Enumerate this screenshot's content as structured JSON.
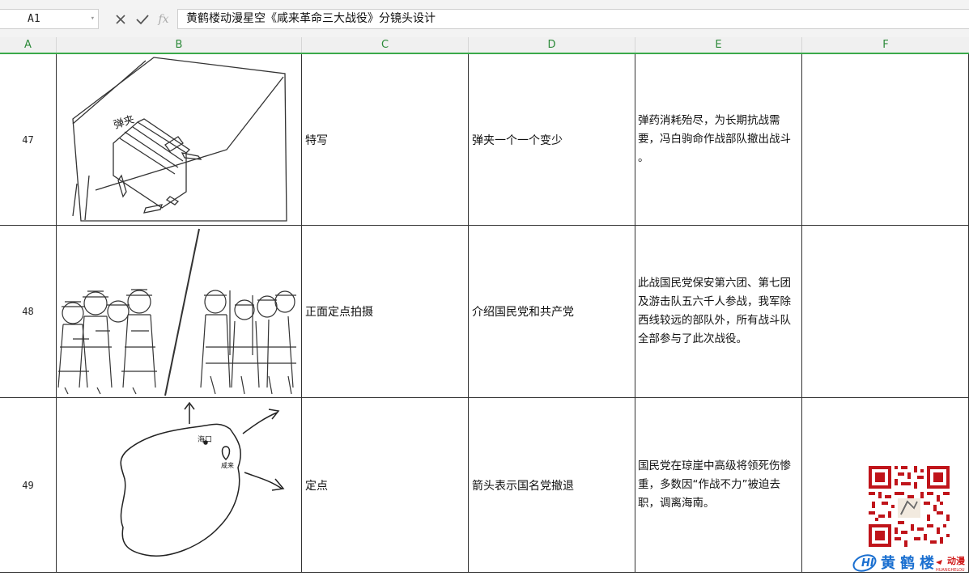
{
  "formula_bar": {
    "name_box": "A1",
    "cancel_icon": "close-icon",
    "enter_icon": "check-icon",
    "fx_label": "fx",
    "formula": "黄鹤楼动漫星空《咸来革命三大战役》分镜头设计"
  },
  "columns": [
    "A",
    "B",
    "C",
    "D",
    "E",
    "F"
  ],
  "rows": [
    {
      "row_label": "47",
      "shot": "特写",
      "description": "弹夹一个一个变少",
      "notes": [
        "弹药消耗殆尽，为长期抗战需",
        "要，冯白驹命作战部队撤出战斗",
        "。"
      ],
      "sketch_labels": [
        "弹夹"
      ]
    },
    {
      "row_label": "48",
      "shot": "正面定点拍摄",
      "description": "介绍国民党和共产党",
      "notes": [
        "此战国民党保安第六团、第七团",
        "及游击队五六千人参战，我军除",
        "西线较远的部队外，所有战斗队",
        "全部参与了此次战役。"
      ],
      "sketch_labels": []
    },
    {
      "row_label": "49",
      "shot": "定点",
      "description": "箭头表示国名党撤退",
      "notes": [
        "国民党在琼崖中高级将领死伤惨",
        "重，多数因“作战不力”被迫去",
        "职，调离海南。"
      ],
      "sketch_labels": [
        "海口",
        "咸来"
      ]
    }
  ],
  "watermark": {
    "brand_text": "黄鹤楼",
    "brand_suffix": "动漫",
    "brand_pinyin": "HUANGHELOU",
    "qr_icon": "qr-code-icon"
  },
  "colors": {
    "header_green": "#2d8a3a",
    "accent_green": "#3aa94a",
    "brand_blue": "#1a6fd0",
    "brand_red": "#d01818"
  }
}
